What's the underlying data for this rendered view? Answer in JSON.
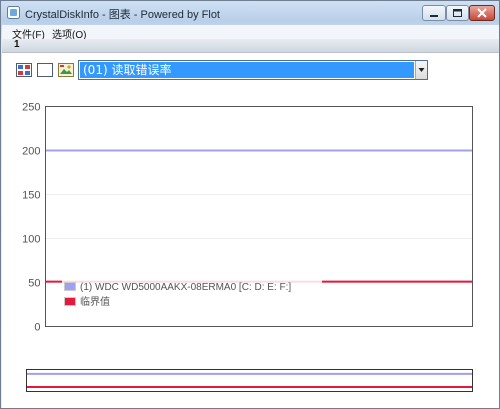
{
  "window": {
    "title": "CrystalDiskInfo - 图表 - Powered by Flot"
  },
  "menu": {
    "file": "文件(F)",
    "options": "选项(O)"
  },
  "tabs": [
    {
      "label": "1"
    }
  ],
  "toolbar": {
    "icons": [
      "chart-colors-icon",
      "blank-frame-icon",
      "image-export-icon"
    ],
    "attribute_select": {
      "value": "(01) 读取错误率"
    }
  },
  "colors": {
    "series_line": "#a0a0f0",
    "threshold_line": "#e8183c",
    "selection_highlight": "#3399ff"
  },
  "chart_data": {
    "type": "line",
    "title": "",
    "xlabel": "",
    "ylabel": "",
    "ylim": [
      0,
      250
    ],
    "yticks": [
      0,
      50,
      100,
      150,
      200,
      250
    ],
    "grid": true,
    "legend_position": "bottom-left",
    "series": [
      {
        "name": "(1) WDC WD5000AAKX-08ERMA0 [C: D: E: F:]",
        "values": [
          200,
          200
        ],
        "color": "#a0a0f0"
      },
      {
        "name": "临界值",
        "values": [
          51,
          51
        ],
        "color": "#e8183c"
      }
    ]
  }
}
